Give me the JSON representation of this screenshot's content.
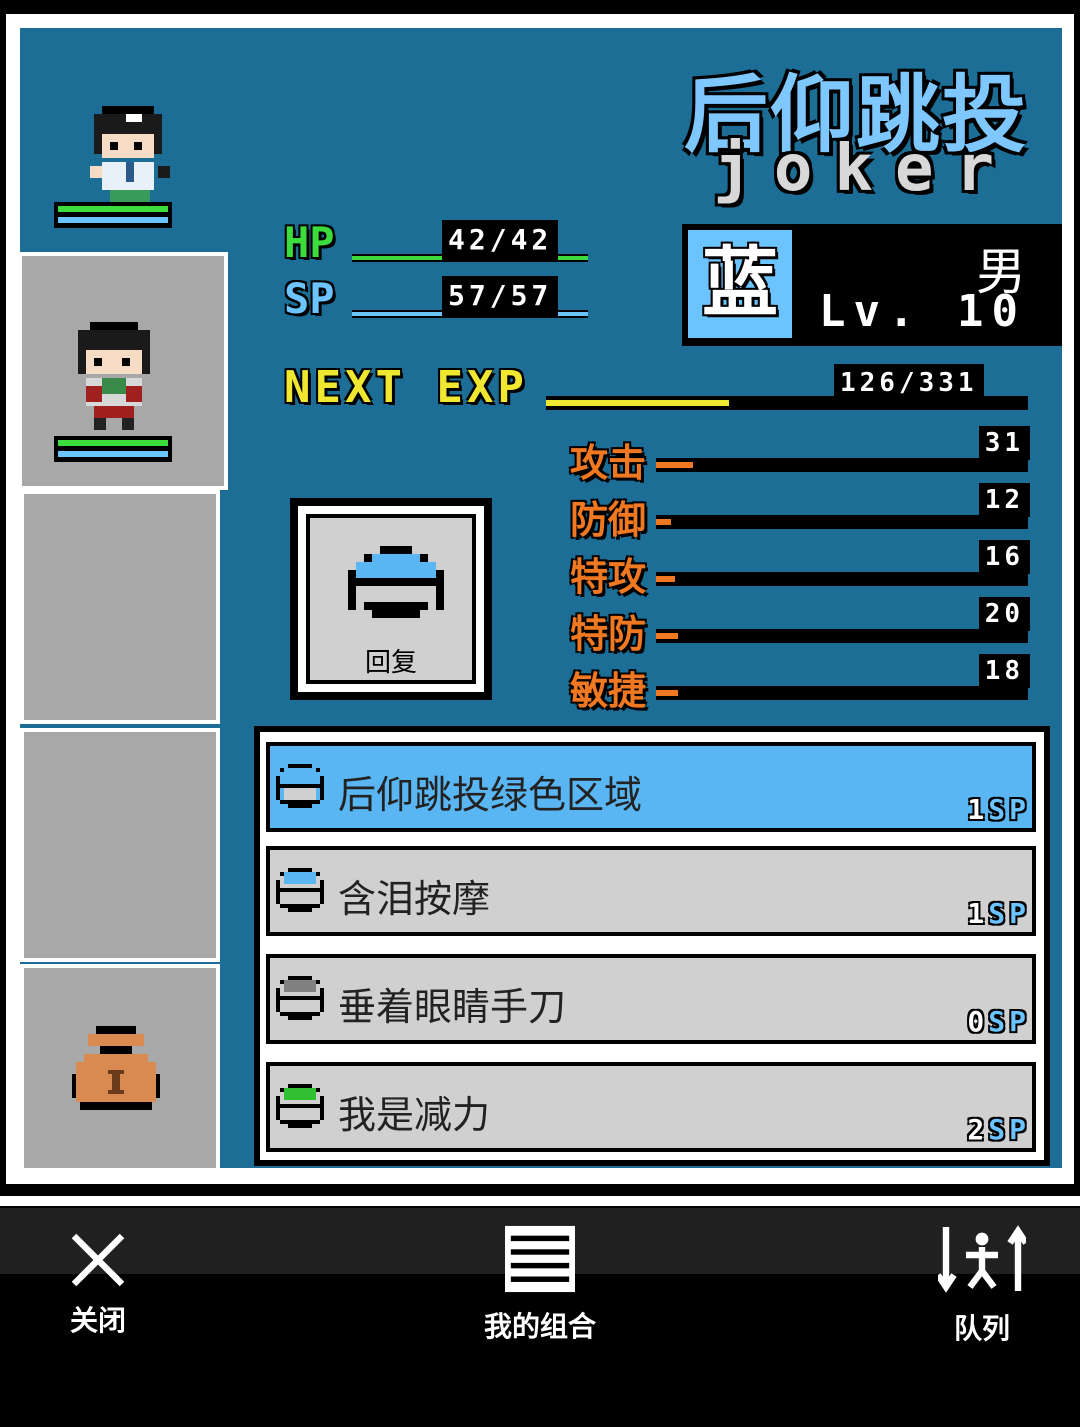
{
  "character": {
    "name": "后仰跳投",
    "player": "joker",
    "element": "蓝",
    "gender": "男",
    "level_label": "Lv.",
    "level": "10"
  },
  "hp": {
    "label": "HP",
    "text": "42/42",
    "current": 42,
    "max": 42
  },
  "sp": {
    "label": "SP",
    "text": "57/57",
    "current": 57,
    "max": 57
  },
  "exp": {
    "label": "NEXT EXP",
    "text": "126/331",
    "current": 126,
    "max": 331
  },
  "attributes": [
    {
      "name": "攻击",
      "value": "31",
      "fill": 0.1
    },
    {
      "name": "防御",
      "value": "12",
      "fill": 0.04
    },
    {
      "name": "特攻",
      "value": "16",
      "fill": 0.05
    },
    {
      "name": "特防",
      "value": "20",
      "fill": 0.06
    },
    {
      "name": "敏捷",
      "value": "18",
      "fill": 0.06
    }
  ],
  "equipped_item": {
    "label": "回复",
    "icon": "blue-capsule-icon"
  },
  "skills": [
    {
      "name": "后仰跳投绿色区域",
      "cost": "1",
      "unit": "SP",
      "selected": true,
      "icon_color": "#5ab6f2"
    },
    {
      "name": "含泪按摩",
      "cost": "1",
      "unit": "SP",
      "selected": false,
      "icon_color": "#5ab6f2"
    },
    {
      "name": "垂着眼睛手刀",
      "cost": "0",
      "unit": "SP",
      "selected": false,
      "icon_color": "#808080"
    },
    {
      "name": "我是减力",
      "cost": "2",
      "unit": "SP",
      "selected": false,
      "icon_color": "#30c030"
    }
  ],
  "party": {
    "slots": [
      "character-1",
      "character-2",
      "empty",
      "empty",
      "bag"
    ],
    "bag_icon": "money-bag-icon"
  },
  "nav": {
    "close": "关闭",
    "combo": "我的组合",
    "queue": "队列"
  },
  "colors": {
    "panel": "#1c6e97",
    "hp": "#3cdc3c",
    "sp": "#6cc4ff",
    "exp": "#f0e830",
    "attr": "#f07820",
    "selected_skill": "#5ab6f2"
  }
}
